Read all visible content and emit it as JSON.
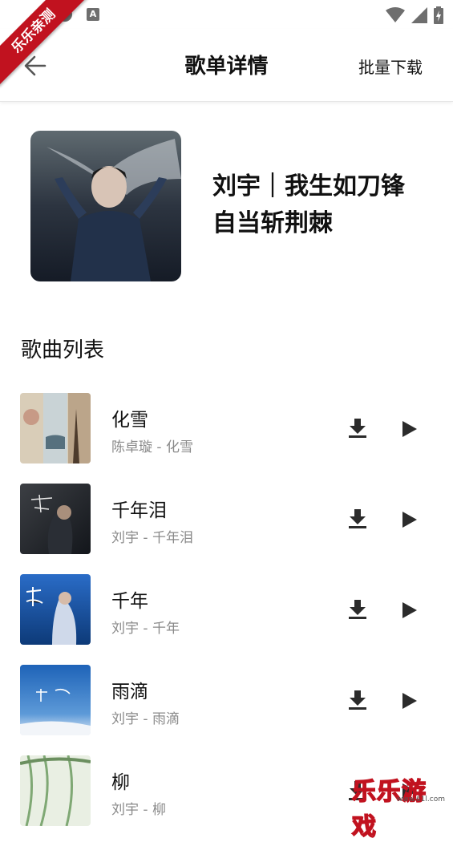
{
  "status": {
    "a_icon": "A"
  },
  "ribbon": {
    "label": "乐乐亲测"
  },
  "header": {
    "title": "歌单详情",
    "batch_download": "批量下载"
  },
  "playlist": {
    "name_line1": "刘宇｜我生如刀锋",
    "name_line2": "自当斩荆棘"
  },
  "section": {
    "title": "歌曲列表"
  },
  "songs": [
    {
      "title": "化雪",
      "subtitle": "陈卓璇 - 化雪"
    },
    {
      "title": "千年泪",
      "subtitle": "刘宇 - 千年泪"
    },
    {
      "title": "千年",
      "subtitle": "刘宇 - 千年"
    },
    {
      "title": "雨滴",
      "subtitle": "刘宇 - 雨滴"
    },
    {
      "title": "柳",
      "subtitle": "刘宇 - 柳"
    }
  ],
  "watermark": {
    "text": "乐乐游戏",
    "url": "www.61l.com"
  },
  "colors": {
    "accent": "#c1121f",
    "subtitle": "#8a8a8a",
    "icon": "#2b2b2b"
  }
}
